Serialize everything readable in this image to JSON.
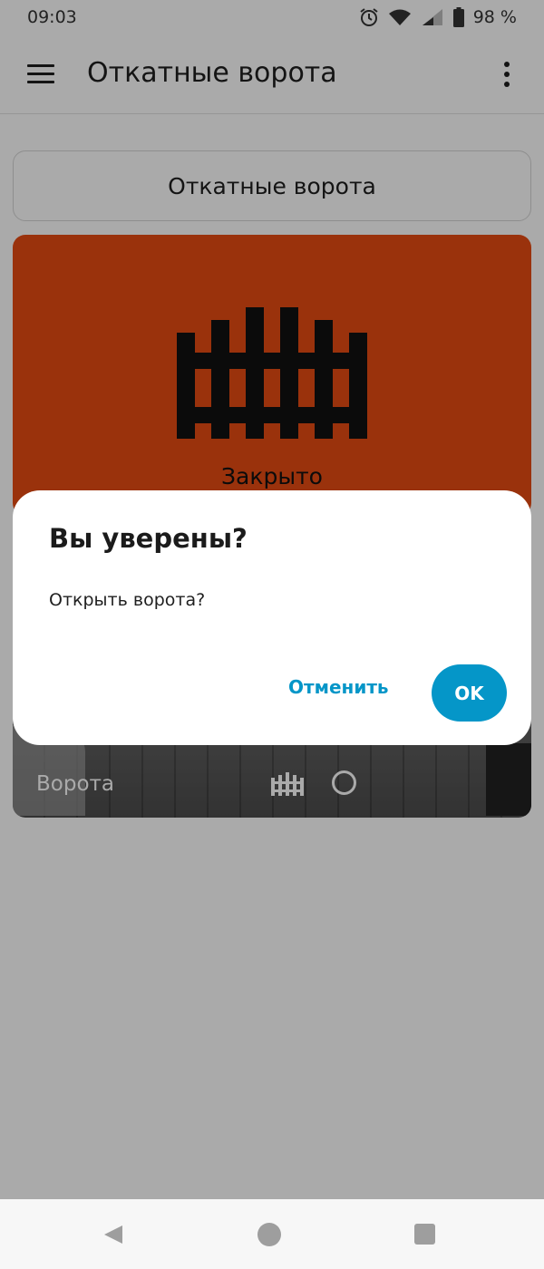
{
  "status_bar": {
    "time": "09:03",
    "battery_text": "98 %"
  },
  "app_bar": {
    "title": "Откатные ворота",
    "menu_icon": "hamburger-menu-icon",
    "more_icon": "more-vert-icon"
  },
  "header_card": {
    "title": "Откатные ворота"
  },
  "gate_card": {
    "state": "Закрыто",
    "icon": "fence-gate-icon",
    "background_color": "#e84b12"
  },
  "camera_card": {
    "label": "Ворота",
    "icons": [
      "fence-gate-icon",
      "circle-icon"
    ]
  },
  "dialog": {
    "title": "Вы уверены?",
    "message": "Открыть ворота?",
    "cancel_label": "Отменить",
    "ok_label": "OK",
    "accent_color": "#0596c8"
  },
  "nav_bar": {
    "icons": [
      "back-icon",
      "home-icon",
      "recents-icon"
    ]
  }
}
